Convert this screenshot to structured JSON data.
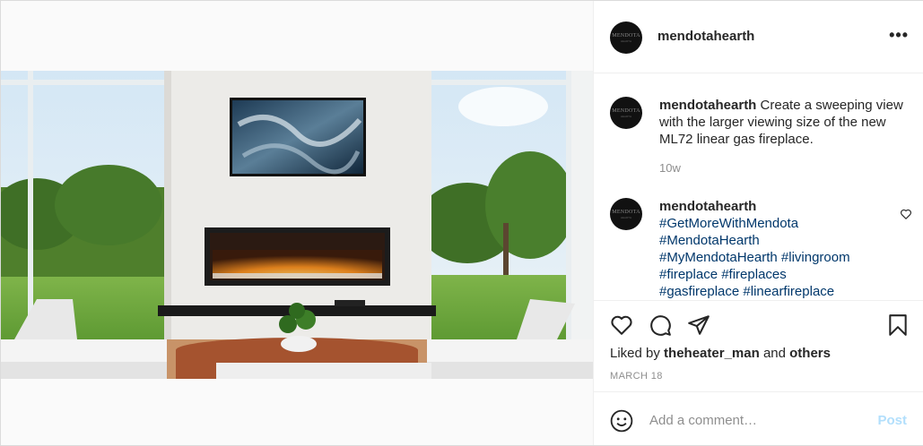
{
  "post": {
    "username": "mendotahearth",
    "more_icon": "more-horizontal-icon",
    "more_label": "•••",
    "avatar_text": "MENDOTA",
    "avatar_subtext": "HEARTH"
  },
  "caption": {
    "username": "mendotahearth",
    "text": "Create a sweeping view with the larger viewing size of the new ML72 linear gas fireplace.",
    "time": "10w"
  },
  "comment": {
    "username": "mendotahearth",
    "hashtags": [
      "#GetMoreWithMendota",
      "#MendotaHearth",
      "#MyMendotaHearth",
      "#livingroom",
      "#fireplace",
      "#fireplaces",
      "#gasfireplace",
      "#linearfireplace"
    ]
  },
  "actions": {
    "like_icon": "heart-icon",
    "comment_icon": "comment-icon",
    "share_icon": "share-icon",
    "save_icon": "bookmark-icon"
  },
  "likes": {
    "prefix": "Liked by",
    "user": "theheater_man",
    "middle": "and",
    "others": "others"
  },
  "date": "MARCH 18",
  "add_comment": {
    "placeholder": "Add a comment…",
    "post_label": "Post"
  },
  "colors": {
    "link": "#00376b",
    "muted": "#8e8e8e",
    "post_disabled": "#b2dffc",
    "border": "#dbdbdb"
  }
}
